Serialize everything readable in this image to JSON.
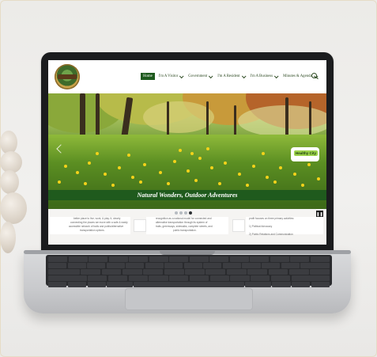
{
  "site": {
    "nav": {
      "items": [
        {
          "label": "Home",
          "active": true
        },
        {
          "label": "I'm A Visitor",
          "dropdown": true
        },
        {
          "label": "Government",
          "dropdown": true
        },
        {
          "label": "I'm A Resident",
          "dropdown": true
        },
        {
          "label": "I'm A Business",
          "dropdown": true
        },
        {
          "label": "Minutes & Agenda",
          "dropdown": true
        }
      ],
      "search_icon": "search-icon"
    },
    "hero": {
      "banner_text": "Natural Wonders, Outdoor Adventures",
      "pill_text": "Healthy City",
      "slider_dots": 4,
      "active_dot": 3
    },
    "cards": [
      {
        "lines": [
          "better place to live, work, & play. It, clearly",
          "connecting the places we move with a safe & easily",
          "accessible network of trails and public/alternative",
          "transportation options."
        ]
      },
      {
        "lines": [
          "recognition as a national model for connected and",
          "alternative transportation through its system of",
          "trails, greenways, sidewalks, complete streets, and",
          "public transportation."
        ]
      },
      {
        "lines": [
          "profit focuses on three primary activities:",
          "",
          "1) Political Advocacy",
          "",
          "2) Public Relations and Communication"
        ]
      }
    ],
    "colors": {
      "brand_green": "#1e5a1e",
      "nav_text": "#2d4a22"
    }
  }
}
